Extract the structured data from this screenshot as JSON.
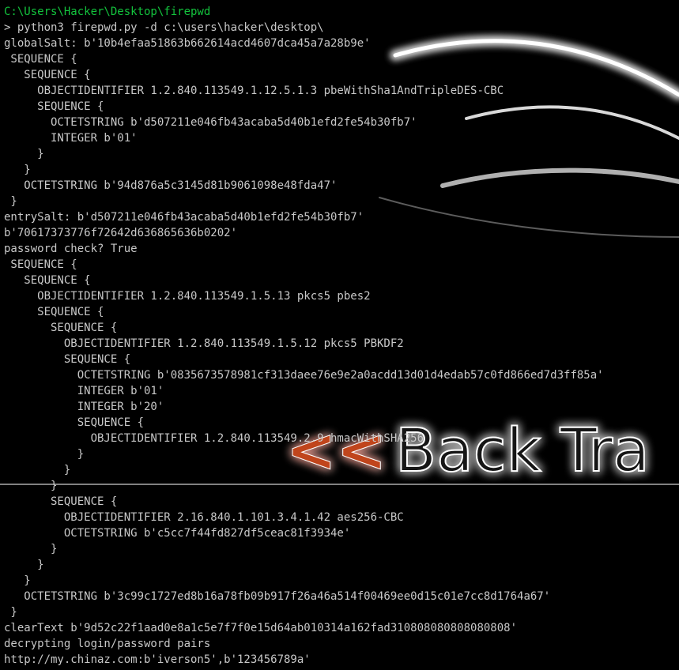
{
  "terminal": {
    "cwd": "C:\\Users\\Hacker\\Desktop\\firepwd",
    "lines": [
      "> python3 firepwd.py -d c:\\users\\hacker\\desktop\\",
      "globalSalt: b'10b4efaa51863b662614acd4607dca45a7a28b9e'",
      " SEQUENCE {",
      "   SEQUENCE {",
      "     OBJECTIDENTIFIER 1.2.840.113549.1.12.5.1.3 pbeWithSha1AndTripleDES-CBC",
      "     SEQUENCE {",
      "       OCTETSTRING b'd507211e046fb43acaba5d40b1efd2fe54b30fb7'",
      "       INTEGER b'01'",
      "     }",
      "   }",
      "   OCTETSTRING b'94d876a5c3145d81b9061098e48fda47'",
      " }",
      "entrySalt: b'd507211e046fb43acaba5d40b1efd2fe54b30fb7'",
      "b'70617373776f72642d636865636b0202'",
      "password check? True",
      " SEQUENCE {",
      "   SEQUENCE {",
      "     OBJECTIDENTIFIER 1.2.840.113549.1.5.13 pkcs5 pbes2",
      "     SEQUENCE {",
      "       SEQUENCE {",
      "         OBJECTIDENTIFIER 1.2.840.113549.1.5.12 pkcs5 PBKDF2",
      "         SEQUENCE {",
      "           OCTETSTRING b'0835673578981cf313daee76e9e2a0acdd13d01d4edab57c0fd866ed7d3ff85a'",
      "           INTEGER b'01'",
      "           INTEGER b'20'",
      "           SEQUENCE {",
      "             OBJECTIDENTIFIER 1.2.840.113549.2.9 hmacWithSHA256",
      "           }",
      "         }",
      "       }",
      "       SEQUENCE {",
      "         OBJECTIDENTIFIER 2.16.840.1.101.3.4.1.42 aes256-CBC",
      "         OCTETSTRING b'c5cc7f44fd827df5ceac81f3934e'",
      "       }",
      "     }",
      "   }",
      "   OCTETSTRING b'3c99c1727ed8b16a78fb09b917f26a46a514f00469ee0d15c01e7cc8d1764a67'",
      " }",
      "clearText b'9d52c22f1aad0e8a1c5e7f7f0e15d64ab010314a162fad310808080808080808'",
      "decrypting login/password pairs",
      "http://my.chinaz.com:b'iverson5',b'123456789a'"
    ]
  },
  "wallpaper": {
    "arrows": "<<",
    "brand": "Back Tra",
    "arrow_color": "#c0441a",
    "brand_color": "#181818",
    "glow_color": "#ffffff"
  }
}
